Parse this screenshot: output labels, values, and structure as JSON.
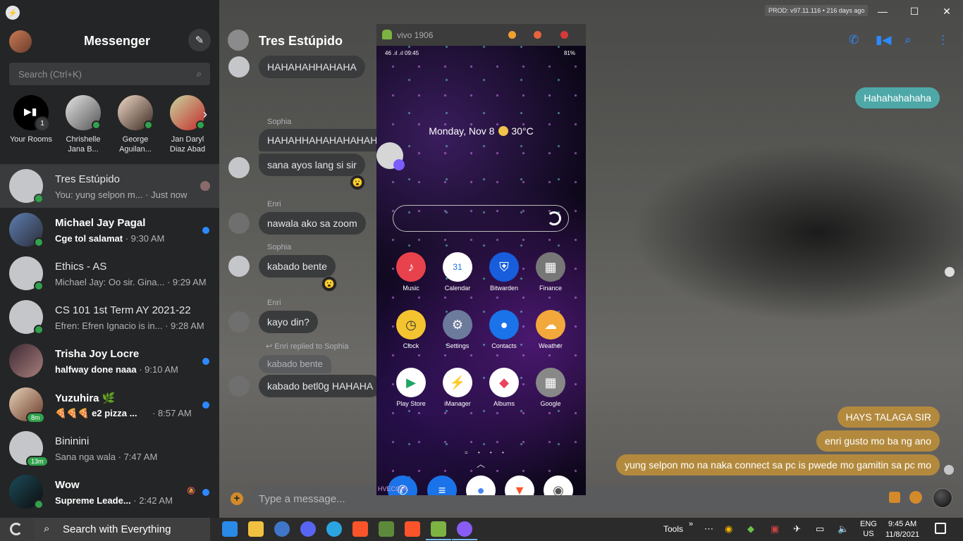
{
  "titlebar": {
    "build": "PROD: v97.11.116 • 216 days ago",
    "minimize": "—",
    "maximize": "☐",
    "close": "✕"
  },
  "sidebar": {
    "title": "Messenger",
    "compose_icon": "✎",
    "search_placeholder": "Search (Ctrl+K)",
    "rooms": [
      {
        "line1": "Your Rooms",
        "line2": "",
        "count": "1"
      },
      {
        "line1": "Chrishelle",
        "line2": "Jana B..."
      },
      {
        "line1": "George",
        "line2": "Aguilan..."
      },
      {
        "line1": "Jan Daryl",
        "line2": "Diaz Abad"
      }
    ],
    "conversations": [
      {
        "name": "Tres Estúpido",
        "snippet": "You: yung selpon m...",
        "time": "· Just now"
      },
      {
        "name": "Michael Jay Pagal",
        "snippet": "Cge tol salamat",
        "time": "· 9:30 AM"
      },
      {
        "name": "Ethics - AS",
        "snippet": "Michael Jay: Oo sir. Gina...",
        "time": "· 9:29 AM"
      },
      {
        "name": "CS 101 1st Term AY 2021-22",
        "snippet": "Efren: Efren Ignacio is in...",
        "time": "· 9:28 AM"
      },
      {
        "name": "Trisha Joy Locre",
        "snippet": "halfway done naaa",
        "time": "· 9:10 AM"
      },
      {
        "name": "Yuzuhira 🌿",
        "snippet": "🍕🍕🍕 e2 pizza ...",
        "time": "· 8:57 AM",
        "badge": "8m"
      },
      {
        "name": "Bininini",
        "snippet": "Sana nga wala",
        "time": "· 7:47 AM",
        "badge": "13m"
      },
      {
        "name": "Wow",
        "snippet": "Supreme Leade...",
        "time": "· 2:42 AM"
      }
    ]
  },
  "chat": {
    "title": "Tres Estúpido",
    "messages": {
      "m1": "HAHAHAHHAHAHA",
      "s1": "Sophia",
      "m2": "HAHAHHAHAHAHAHAHA",
      "m3": "sana ayos lang si sir",
      "s2": "Enri",
      "m4": "nawala ako sa zoom",
      "s3": "Sophia",
      "m5": "kabado bente",
      "s4": "Enri",
      "m6": "kayo din?",
      "reply_hint": "Enri replied to Sophia",
      "quoted": "kabado bente",
      "m7": "kabado betl0g HAHAHA"
    },
    "outgoing": {
      "o1": "Hahahahahaha",
      "o2": "HAYS TALAGA SIR",
      "o3": "enri gusto mo ba ng ano",
      "o4": "yung selpon mo na naka connect sa pc is pwede mo gamitin sa pc mo"
    },
    "composer_placeholder": "Type a message..."
  },
  "phone": {
    "window_title": "vivo 1906",
    "status_left": "46 .ıl .ıl 09:45",
    "status_right": "81%",
    "date_weather": "Monday, Nov 8",
    "temp": "30°C",
    "apps": [
      {
        "label": "Music",
        "color": "#e8424d",
        "glyph": "♪"
      },
      {
        "label": "Calendar",
        "color": "#ffffff",
        "glyph": "31"
      },
      {
        "label": "Bitwarden",
        "color": "#175ddc",
        "glyph": "⛨"
      },
      {
        "label": "Finance",
        "color": "#777777",
        "glyph": "▦"
      },
      {
        "label": "Clock",
        "color": "#f4c430",
        "glyph": "◷"
      },
      {
        "label": "Settings",
        "color": "#6c7a9c",
        "glyph": "⚙"
      },
      {
        "label": "Contacts",
        "color": "#1a73e8",
        "glyph": "●"
      },
      {
        "label": "Weather",
        "color": "#f3a83b",
        "glyph": "☁"
      },
      {
        "label": "Play Store",
        "color": "#ffffff",
        "glyph": "▶"
      },
      {
        "label": "iManager",
        "color": "#ffffff",
        "glyph": "⚡"
      },
      {
        "label": "Albums",
        "color": "#ffffff",
        "glyph": "◆"
      },
      {
        "label": "Google",
        "color": "#888888",
        "glyph": "▦"
      }
    ],
    "watermark": "HVECOVA"
  },
  "taskbar": {
    "search": "Search with Everything",
    "tools": "Tools",
    "lang1": "ENG",
    "lang2": "US",
    "time": "9:45 AM",
    "date": "11/8/2021"
  }
}
